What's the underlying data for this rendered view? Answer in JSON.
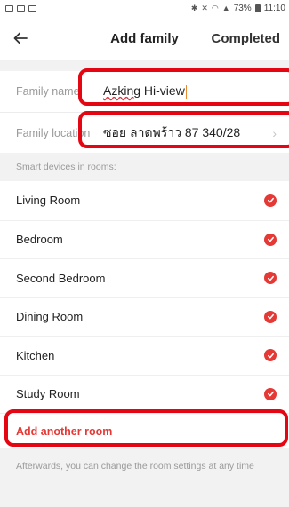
{
  "status_bar": {
    "battery": "73%",
    "time": "11:10"
  },
  "nav": {
    "title": "Add family",
    "done_label": "Completed"
  },
  "form": {
    "family_name_label": "Family name",
    "family_name_value_underlined": "Azking",
    "family_name_value_rest": " Hi-view",
    "family_location_label": "Family location",
    "family_location_value": "ซอย ลาดพร้าว 87 340/28"
  },
  "rooms_hint": "Smart devices in rooms:",
  "rooms": [
    {
      "name": "Living Room",
      "checked": true
    },
    {
      "name": "Bedroom",
      "checked": true
    },
    {
      "name": "Second Bedroom",
      "checked": true
    },
    {
      "name": "Dining Room",
      "checked": true
    },
    {
      "name": "Kitchen",
      "checked": true
    },
    {
      "name": "Study Room",
      "checked": true
    }
  ],
  "add_room_label": "Add another room",
  "footer_hint": "Afterwards, you can change the room settings at any time",
  "colors": {
    "accent": "#e53935",
    "highlight": "#e40613"
  }
}
